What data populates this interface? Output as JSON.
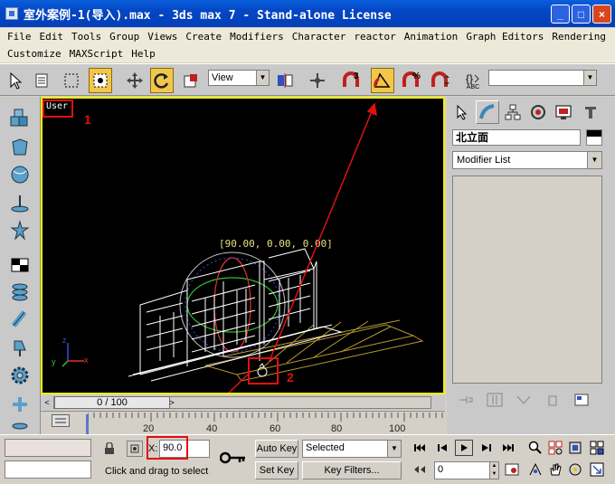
{
  "window": {
    "title": "室外案例-1(导入).max - 3ds max 7  - Stand-alone License",
    "minimize": "_",
    "maximize": "□",
    "close": "×"
  },
  "menu": {
    "row1": [
      "File",
      "Edit",
      "Tools",
      "Group",
      "Views",
      "Create",
      "Modifiers",
      "Character",
      "reactor",
      "Animation",
      "Graph Editors",
      "Rendering"
    ],
    "row2": [
      "Customize",
      "MAXScript",
      "Help"
    ]
  },
  "toolbar": {
    "coord_system": "View",
    "named_selection": "",
    "angle_snap_label": "3",
    "percent_snap_label": "%",
    "abc_label": "ABC"
  },
  "viewport": {
    "label": "User",
    "rotation_readout": "[90.00, 0.00, 0.00]",
    "axis_x": "x",
    "axis_y": "y",
    "axis_z": "z",
    "colors": {
      "border": "#f0f000",
      "wire": "#ffffff",
      "footprint": "#b89a30",
      "gizmo_x": "#e03030",
      "gizmo_y": "#30c030",
      "gizmo_z": "#3050e0"
    }
  },
  "annotations": {
    "marker_1": "1",
    "marker_2": "2",
    "color": "#e01010"
  },
  "time_slider": {
    "position": "0 / 100",
    "ticks": [
      "20",
      "40",
      "60",
      "80",
      "100"
    ]
  },
  "command_panel": {
    "object_name": "北立面",
    "modifier_list": "Modifier List"
  },
  "status": {
    "x_label": "X:",
    "x_value": "90.0",
    "prompt": "Click and drag to select a",
    "auto_key": "Auto Key",
    "set_key": "Set Key",
    "key_filter_mode": "Selected",
    "key_filters": "Key Filters...",
    "frame_value": "0"
  }
}
